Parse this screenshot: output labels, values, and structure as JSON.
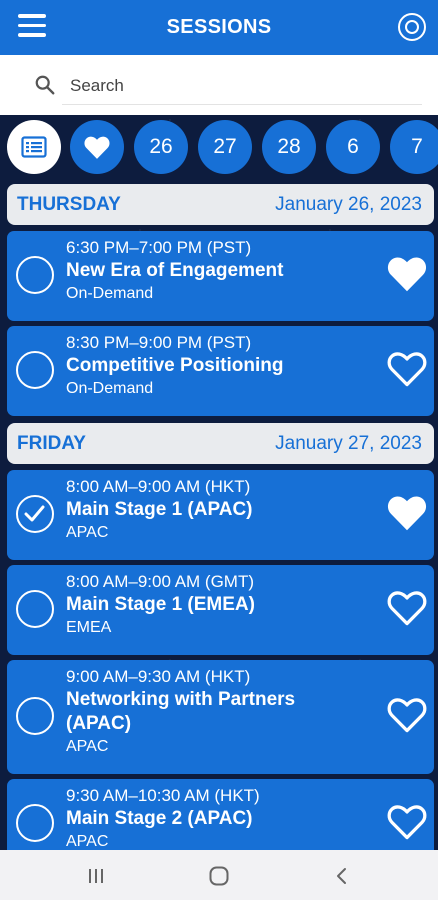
{
  "header": {
    "title": "SESSIONS",
    "menu_icon": "hamburger-menu-icon",
    "settings_icon": "settings-icon"
  },
  "search": {
    "placeholder": "Search",
    "value": ""
  },
  "filters": {
    "list_icon": "list-view-icon",
    "favorites_icon": "heart-icon",
    "dates": [
      "26",
      "27",
      "28",
      "6",
      "7"
    ]
  },
  "days": [
    {
      "name": "THURSDAY",
      "date": "January 26, 2023",
      "sessions": [
        {
          "time": "6:30 PM–7:00 PM (PST)",
          "title": "New Era of Engagement",
          "track": "On-Demand",
          "checked": false,
          "favorite": true
        },
        {
          "time": "8:30 PM–9:00 PM (PST)",
          "title": "Competitive Positioning",
          "track": "On-Demand",
          "checked": false,
          "favorite": false
        }
      ]
    },
    {
      "name": "FRIDAY",
      "date": "January 27, 2023",
      "sessions": [
        {
          "time": "8:00 AM–9:00 AM (HKT)",
          "title": "Main Stage 1  (APAC)",
          "track": "APAC",
          "checked": true,
          "favorite": true
        },
        {
          "time": "8:00 AM–9:00 AM (GMT)",
          "title": "Main Stage 1 (EMEA)",
          "track": "EMEA",
          "checked": false,
          "favorite": false
        },
        {
          "time": "9:00 AM–9:30 AM (HKT)",
          "title": "Networking with Partners (APAC)",
          "track": "APAC",
          "checked": false,
          "favorite": false
        },
        {
          "time": "9:30 AM–10:30 AM (HKT)",
          "title": "Main Stage 2  (APAC)",
          "track": "APAC",
          "checked": false,
          "favorite": false
        }
      ]
    }
  ],
  "colors": {
    "accent": "#1770d6",
    "header_bg": "#e9ebee",
    "background": "#0d1c3e"
  },
  "navbar": {
    "icons": [
      "recent-apps-icon",
      "home-icon",
      "back-icon"
    ]
  }
}
